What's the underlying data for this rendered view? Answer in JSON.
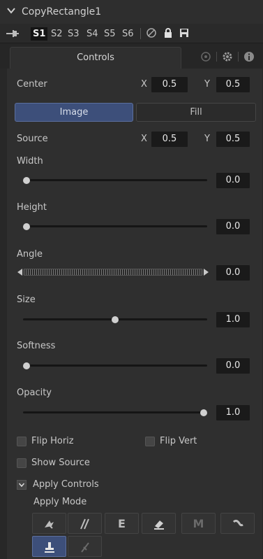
{
  "header": {
    "title": "CopyRectangle1"
  },
  "slots": [
    "S1",
    "S2",
    "S3",
    "S4",
    "S5",
    "S6"
  ],
  "tabs": {
    "controls": "Controls"
  },
  "center": {
    "label": "Center",
    "x_label": "X",
    "x_value": "0.5",
    "y_label": "Y",
    "y_value": "0.5"
  },
  "segment": {
    "image": "Image",
    "fill": "Fill"
  },
  "source": {
    "label": "Source",
    "x_label": "X",
    "x_value": "0.5",
    "y_label": "Y",
    "y_value": "0.5"
  },
  "width": {
    "label": "Width",
    "value": "0.0",
    "level": 0.0
  },
  "height": {
    "label": "Height",
    "value": "0.0",
    "level": 0.0
  },
  "angle": {
    "label": "Angle",
    "value": "0.0"
  },
  "size": {
    "label": "Size",
    "value": "1.0",
    "level": 0.5
  },
  "softness": {
    "label": "Softness",
    "value": "0.0",
    "level": 0.0
  },
  "opacity": {
    "label": "Opacity",
    "value": "1.0",
    "level": 1.0
  },
  "checkboxes": {
    "flip_horiz": "Flip Horiz",
    "flip_vert": "Flip Vert",
    "show_source": "Show Source"
  },
  "apply": {
    "controls_label": "Apply Controls",
    "mode_label": "Apply Mode"
  },
  "colors": {
    "accent": "#3d4f7a",
    "panel": "#2f2f2f",
    "field": "#1a1a1a"
  }
}
